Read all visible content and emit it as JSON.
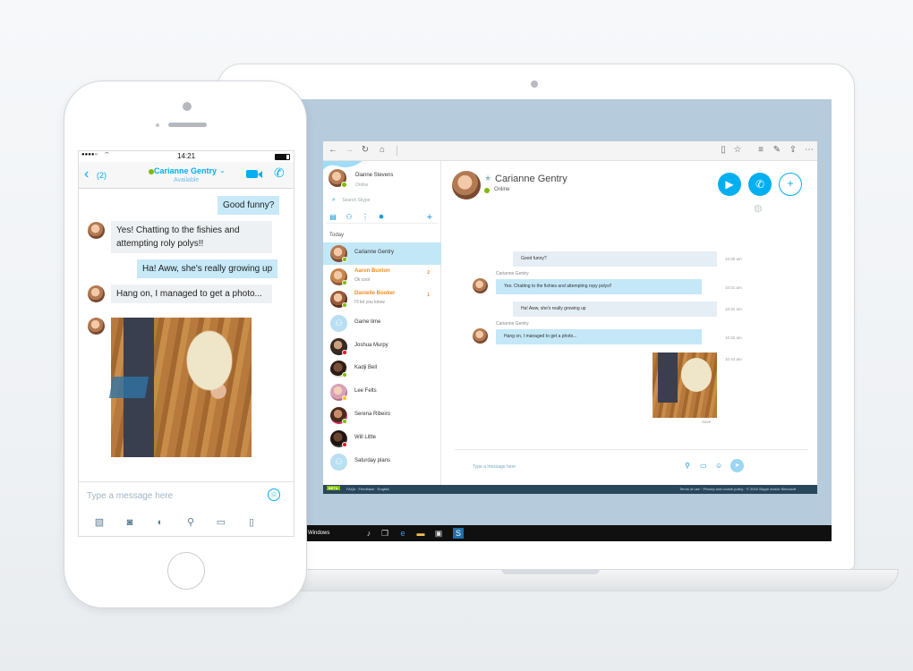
{
  "colors": {
    "accent": "#00aff0",
    "online": "#7fba00",
    "busy": "#e81123",
    "away": "#ffc20e",
    "unread": "#f28c28",
    "bubble_out": "#c4e8f8",
    "screen_bg": "#b6cbdc"
  },
  "phone": {
    "status_bar": {
      "signal": "●●●●○",
      "time": "14:21"
    },
    "nav": {
      "back_count": "(2)",
      "contact_name": "Carianne Gentry",
      "contact_status": "Available"
    },
    "messages": [
      {
        "direction": "out",
        "text": "Good funny?"
      },
      {
        "direction": "in",
        "text": "Yes! Chatting to the fishies and attempting roly polys!!"
      },
      {
        "direction": "out",
        "text": "Ha! Aww, she's really growing up"
      },
      {
        "direction": "in",
        "text": "Hang on, I managed to get a photo..."
      },
      {
        "direction": "in",
        "type": "photo"
      }
    ],
    "compose_placeholder": "Type a message here",
    "toolbar_icons": [
      "media-icon",
      "camera-icon",
      "video-message-icon",
      "location-icon",
      "contact-card-icon",
      "file-icon"
    ]
  },
  "desktop": {
    "profile": {
      "name": "Dianne Stevens",
      "status": "Online",
      "search_placeholder": "Search Skype"
    },
    "section_label": "Today",
    "contacts": [
      {
        "name": "Carianne Gentry",
        "sub": "",
        "badge": "",
        "status": "online",
        "active": true
      },
      {
        "name": "Aaron Buxton",
        "sub": "Ok cool",
        "badge": "2",
        "status": "online",
        "unread": true
      },
      {
        "name": "Danielle Booker",
        "sub": "I'll let you know",
        "badge": "1",
        "status": "online",
        "unread": true
      },
      {
        "name": "Game time",
        "sub": "",
        "badge": "",
        "status": "group"
      },
      {
        "name": "Joshua Murpy",
        "sub": "",
        "badge": "",
        "status": "busy"
      },
      {
        "name": "Kadji Bell",
        "sub": "",
        "badge": "",
        "status": "online"
      },
      {
        "name": "Lee Felts",
        "sub": "",
        "badge": "",
        "status": "away"
      },
      {
        "name": "Serena Ribeiro",
        "sub": "",
        "badge": "",
        "status": "online"
      },
      {
        "name": "Will Little",
        "sub": "",
        "badge": "",
        "status": "busy"
      },
      {
        "name": "Saturday plans",
        "sub": "",
        "badge": "",
        "status": "group"
      }
    ],
    "conversation": {
      "name": "Carianne Gentry",
      "status": "Online",
      "messages": [
        {
          "direction": "out",
          "text": "Good funny?",
          "time": "10:30 am"
        },
        {
          "direction": "in",
          "sender": "Carianne Gentry",
          "text": "Yes: Chatting to the fishies and attempting ropy polys!!",
          "time": "10:31 am"
        },
        {
          "direction": "out",
          "text": "Ha! Aww, she's really growing up",
          "time": "10:31 am"
        },
        {
          "direction": "in",
          "sender": "Carianne Gentry",
          "text": "Hang on, I managed to get a photo...",
          "time": "10:32 am"
        },
        {
          "direction": "in",
          "type": "photo",
          "time": "10:44 am",
          "caption": "Save"
        }
      ],
      "compose_placeholder": "Type a message here"
    },
    "status_strip": {
      "badge": "BETA",
      "links": "FAQs · Feedback · English",
      "right": "Terms of use · Privacy and cookie policy · © 2016 Skype and/or Microsoft"
    },
    "taskbar": {
      "label": "Windows"
    }
  }
}
